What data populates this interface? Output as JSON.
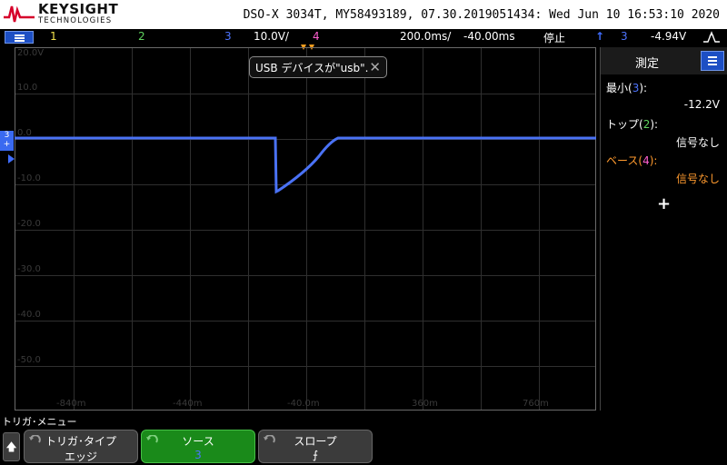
{
  "brand": {
    "name": "KEYSIGHT",
    "sub": "TECHNOLOGIES"
  },
  "instrument_info": "DSO-X 3034T, MY58493189, 07.30.2019051434: Wed Jun 10 16:53:10 2020",
  "status": {
    "ch1": "1",
    "ch2": "2",
    "ch3": "3",
    "ch3_scale": "10.0V/",
    "ch4": "4",
    "timebase": "200.0ms/",
    "delay": "-40.00ms",
    "run_state": "停止",
    "trigger_icon": "↑",
    "trigger_source": "3",
    "trigger_level": "-4.94V",
    "trigger_slope_icon": "rising-falling-edge-icon",
    "colors": {
      "ch1": "#f0e04c",
      "ch2": "#5fd35f",
      "ch3": "#4d74ff",
      "ch4": "#ff5fd0",
      "trigger": "#3f6dff"
    }
  },
  "graticule": {
    "y_labels": [
      "20.0V",
      "10.0",
      "0.0",
      "-10.0",
      "-20.0",
      "-30.0",
      "-40.0",
      "-50.0"
    ],
    "x_labels": [
      "-840m",
      "-440m",
      "-40.0m",
      "360m",
      "760m"
    ]
  },
  "channel_marker": {
    "channel": "3",
    "suffix": "+"
  },
  "popup": {
    "text": "USB デバイスが\"usb\"."
  },
  "waveform": {
    "channel": "3",
    "color": "#4a72f5"
  },
  "measure": {
    "title": "測定",
    "items": [
      {
        "label": "最小(3):",
        "value": "-12.2V",
        "color": "#ffffff"
      },
      {
        "label": "トップ(2):",
        "value": "信号なし",
        "color": "#ffffff"
      },
      {
        "label": "ベース(4):",
        "value": "信号なし",
        "color": "#ff9a2e"
      }
    ],
    "add_label": "+"
  },
  "softkeys": {
    "title": "トリガ･メニュー",
    "keys": [
      {
        "label": "トリガ･タイプ",
        "value": "エッジ"
      },
      {
        "label": "ソース",
        "value": "3"
      },
      {
        "label": "スロープ",
        "value": "⨍"
      }
    ]
  }
}
